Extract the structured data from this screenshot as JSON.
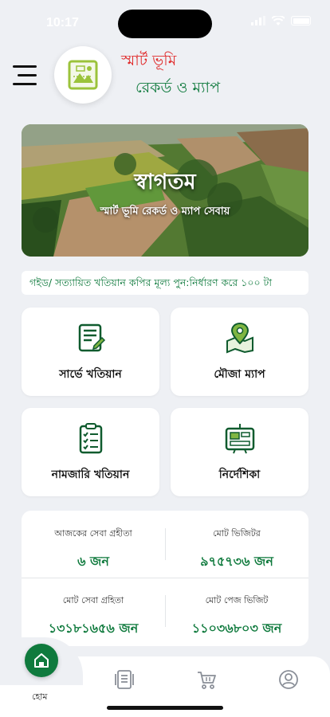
{
  "status_bar": {
    "time": "10:17"
  },
  "header": {
    "title_line1": "স্মার্ট ভূমি",
    "title_line2": "রেকর্ড ও ম্যাপ"
  },
  "banner": {
    "title": "স্বাগতম",
    "subtitle": "স্মার্ট ভূমি রেকর্ড ও ম্যাপ সেবায়"
  },
  "notice": {
    "text": "গইড/ সত্যায়িত খতিয়ান কপির মূল্য পুন:নির্ধারণ করে ১০০ টা"
  },
  "cards": [
    {
      "label": "সার্ভে খতিয়ান",
      "icon": "document-list-icon"
    },
    {
      "label": "মৌজা ম্যাপ",
      "icon": "map-pin-icon"
    },
    {
      "label": "নামজারি খতিয়ান",
      "icon": "checklist-icon"
    },
    {
      "label": "নির্দেশিকা",
      "icon": "guide-board-icon"
    }
  ],
  "stats": {
    "today_receivers_label": "আজকের সেবা গ্রহীতা",
    "today_receivers_value": "৬ জন",
    "total_visitors_label": "মোট ভিজিটর",
    "total_visitors_value": "৯৭৫৭৩৬ জন",
    "total_receivers_label": "মোট সেবা গ্রহিতা",
    "total_receivers_value": "১৩১৮১৬৫৬ জন",
    "total_page_visits_label": "মোট পেজ ভিজিট",
    "total_page_visits_value": "১১০৩৬৮০৩ জন"
  },
  "bottom_nav": {
    "home_label": "হোম",
    "items": [
      "home-icon",
      "documents-icon",
      "cart-icon",
      "profile-icon"
    ]
  },
  "colors": {
    "brand_green": "#0f7a3d",
    "title_red": "#e02b2b",
    "background": "#eef0f4"
  }
}
